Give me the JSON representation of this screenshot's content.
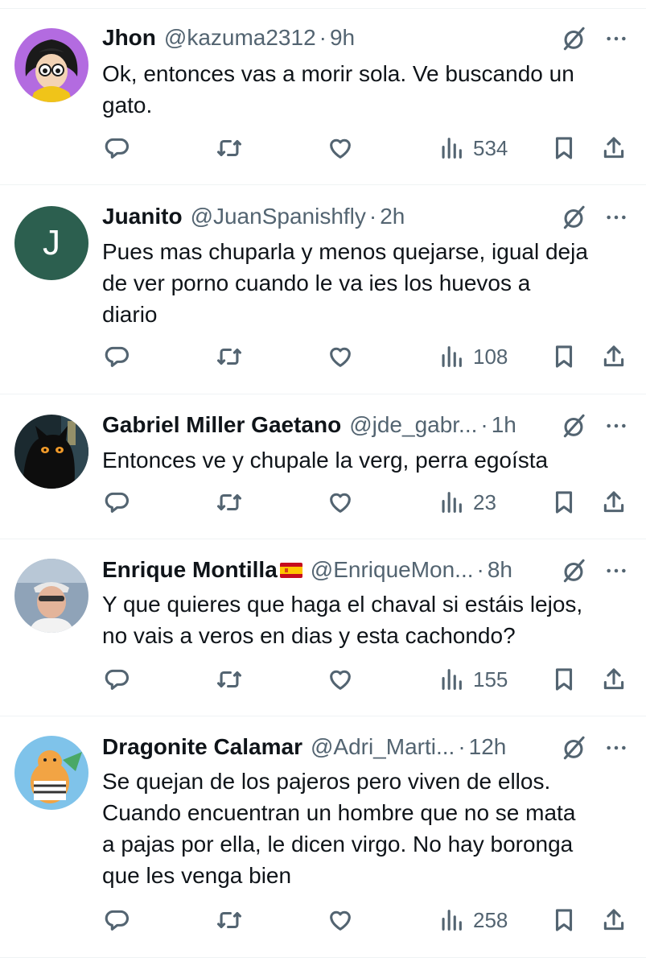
{
  "colors": {
    "text": "#0f1419",
    "secondary": "#536471",
    "divider": "#eff3f4"
  },
  "posts": [
    {
      "name": "Jhon",
      "handle": "@kazuma2312",
      "separator": "·",
      "time": "9h",
      "text": "Ok, entonces vas a morir sola. Ve buscando un\ngato.",
      "views": "534"
    },
    {
      "name": "Juanito",
      "handle": "@JuanSpanishfly",
      "separator": "·",
      "time": "2h",
      "avatar_letter": "J",
      "text": "Pues mas chuparla y menos quejarse, igual deja\nde ver porno cuando le va ies los huevos a\ndiario",
      "views": "108"
    },
    {
      "name": "Gabriel Miller Gaetano",
      "handle": "@jde_gabr...",
      "separator": "·",
      "time": "1h",
      "text": "Entonces ve y chupale la verg, perra egoísta",
      "views": "23"
    },
    {
      "name": "Enrique Montilla",
      "handle": "@EnriqueMon...",
      "separator": "·",
      "time": "8h",
      "text": "Y que quieres que haga el chaval si estáis lejos,\nno vais a veros en dias y esta cachondo?",
      "views": "155"
    },
    {
      "name": "Dragonite Calamar",
      "handle": "@Adri_Marti...",
      "separator": "·",
      "time": "12h",
      "text": "Se quejan de los pajeros pero viven de ellos.\nCuando encuentran un hombre que no se mata\na pajas por ella, le dicen virgo. No hay boronga\nque les venga bien",
      "views": "258"
    }
  ]
}
